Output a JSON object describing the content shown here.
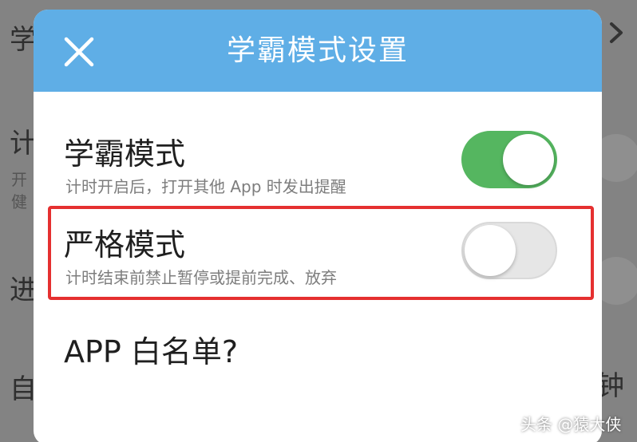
{
  "background": {
    "row1_fragment": "学",
    "row2_fragment": "计",
    "row2_sub_line1": "开",
    "row2_sub_line2": "健",
    "row3_fragment": "进",
    "row4_fragment": "自",
    "row4_right_fragment": "钟"
  },
  "dialog": {
    "title": "学霸模式设置",
    "close_icon": "close-icon"
  },
  "settings": [
    {
      "title": "学霸模式",
      "description": "计时开启后，打开其他 App 时发出提醒",
      "enabled": true
    },
    {
      "title": "严格模式",
      "description": "计时结束前禁止暂停或提前完成、放弃",
      "enabled": false
    }
  ],
  "whitelist": {
    "label": "APP 白名单?"
  },
  "watermark": "头条 @猿大侠",
  "colors": {
    "header": "#5faee6",
    "toggle_on": "#55b660",
    "toggle_off": "#e6e6e6",
    "highlight": "#e53030"
  }
}
